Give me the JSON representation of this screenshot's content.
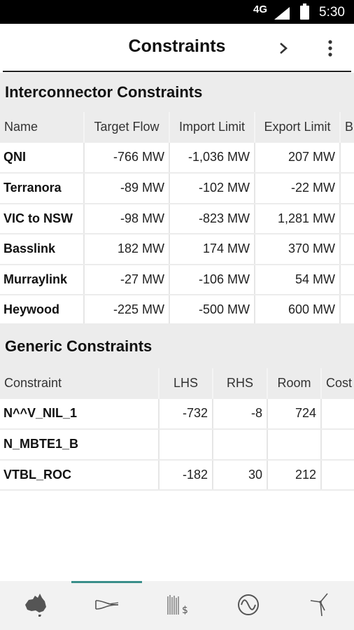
{
  "status_bar": {
    "network": "4G",
    "time": "5:30"
  },
  "toolbar": {
    "title": "Constraints",
    "icons": [
      "chevron-right-icon",
      "more-vert-icon"
    ]
  },
  "interconnector": {
    "title": "Interconnector Constraints",
    "columns": [
      "Name",
      "Target Flow",
      "Import Limit",
      "Export Limit",
      "B"
    ],
    "rows": [
      {
        "name": "QNI",
        "target": "-766 MW",
        "import": "-1,036 MW",
        "export": "207 MW"
      },
      {
        "name": "Terranora",
        "target": "-89 MW",
        "import": "-102 MW",
        "export": "-22 MW"
      },
      {
        "name": "VIC to NSW",
        "target": "-98 MW",
        "import": "-823 MW",
        "export": "1,281 MW"
      },
      {
        "name": "Basslink",
        "target": "182 MW",
        "import": "174 MW",
        "export": "370 MW"
      },
      {
        "name": "Murraylink",
        "target": "-27 MW",
        "import": "-106 MW",
        "export": "54 MW"
      },
      {
        "name": "Heywood",
        "target": "-225 MW",
        "import": "-500 MW",
        "export": "600 MW"
      }
    ]
  },
  "generic": {
    "title": "Generic Constraints",
    "columns": [
      "Constraint",
      "LHS",
      "RHS",
      "Room",
      "Cost"
    ],
    "rows": [
      {
        "name": "N^^V_NIL_1",
        "lhs": "-732",
        "rhs": "-8",
        "room": "724"
      },
      {
        "name": "N_MBTE1_B",
        "lhs": "",
        "rhs": "",
        "room": ""
      },
      {
        "name": "VTBL_ROC",
        "lhs": "-182",
        "rhs": "30",
        "room": "212"
      }
    ]
  },
  "bottom_nav": {
    "active_index": 1,
    "tabs": [
      "australia-map-icon",
      "interconnector-icon",
      "price-icon",
      "frequency-icon",
      "wind-turbine-icon"
    ]
  },
  "colors": {
    "accent": "#3a8f8a",
    "header_bg": "#ececec",
    "status_bar": "#000000"
  }
}
